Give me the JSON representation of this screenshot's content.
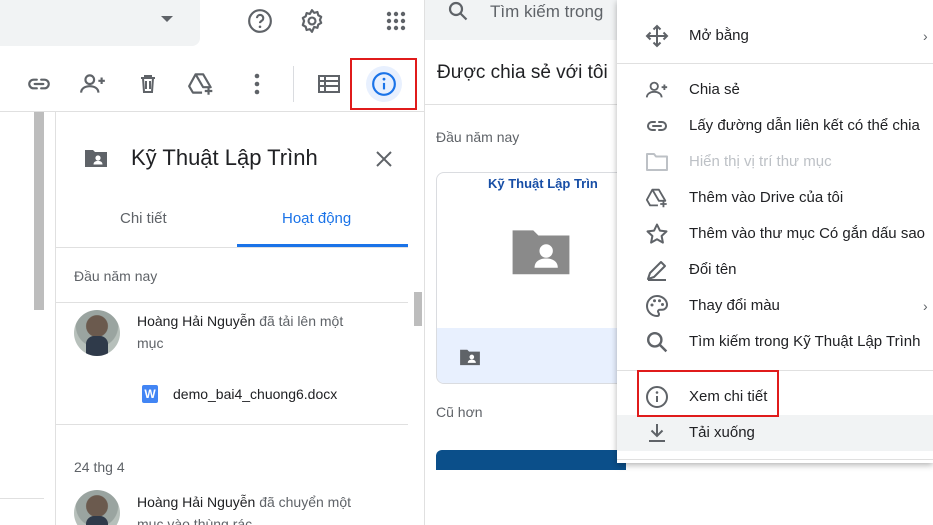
{
  "details_panel": {
    "title": "Kỹ Thuật Lập Trình",
    "tabs": [
      {
        "label": "Chi tiết",
        "active": false
      },
      {
        "label": "Hoạt động",
        "active": true
      }
    ],
    "sections": [
      {
        "label": "Đầu năm nay",
        "activity": {
          "user": "Hoàng Hải Nguyễn",
          "action_line1": "đã tải lên một",
          "action_line2": "mục",
          "file": "demo_bai4_chuong6.docx",
          "file_icon_letter": "W"
        }
      },
      {
        "label": "24 thg 4",
        "activity": {
          "user": "Hoàng Hải Nguyễn",
          "action_line1": "đã chuyển một",
          "action_line2": "mục vào thùng rác"
        }
      }
    ]
  },
  "middle": {
    "search_placeholder": "Tìm kiếm trong",
    "title": "Được chia sẻ với tôi",
    "section_recent": "Đầu năm nay",
    "section_older": "Cũ hơn",
    "card_name": "Kỹ Thuật Lập Trìn"
  },
  "context_menu": {
    "items": [
      {
        "label": "Mở bằng",
        "icon": "move-arrows-icon",
        "submenu": true
      },
      {
        "label": "Chia sẻ",
        "icon": "person-add-icon"
      },
      {
        "label": "Lấy đường dẫn liên kết có thể chia",
        "icon": "link-icon"
      },
      {
        "label": "Hiển thị vị trí thư mục",
        "icon": "folder-icon",
        "disabled": true
      },
      {
        "label": "Thêm vào Drive của tôi",
        "icon": "drive-add-icon"
      },
      {
        "label": "Thêm vào thư mục Có gắn dấu sao",
        "icon": "star-icon"
      },
      {
        "label": "Đổi tên",
        "icon": "pencil-icon"
      },
      {
        "label": "Thay đổi màu",
        "icon": "palette-icon",
        "submenu": true
      },
      {
        "label": "Tìm kiếm trong Kỹ Thuật Lập Trình",
        "icon": "search-icon"
      },
      {
        "label": "Xem chi tiết",
        "icon": "info-icon"
      },
      {
        "label": "Tải xuống",
        "icon": "download-icon"
      }
    ]
  },
  "colors": {
    "accent": "#1a73e8",
    "highlight_box": "#e01b1b",
    "icon_gray": "#5f6368"
  }
}
